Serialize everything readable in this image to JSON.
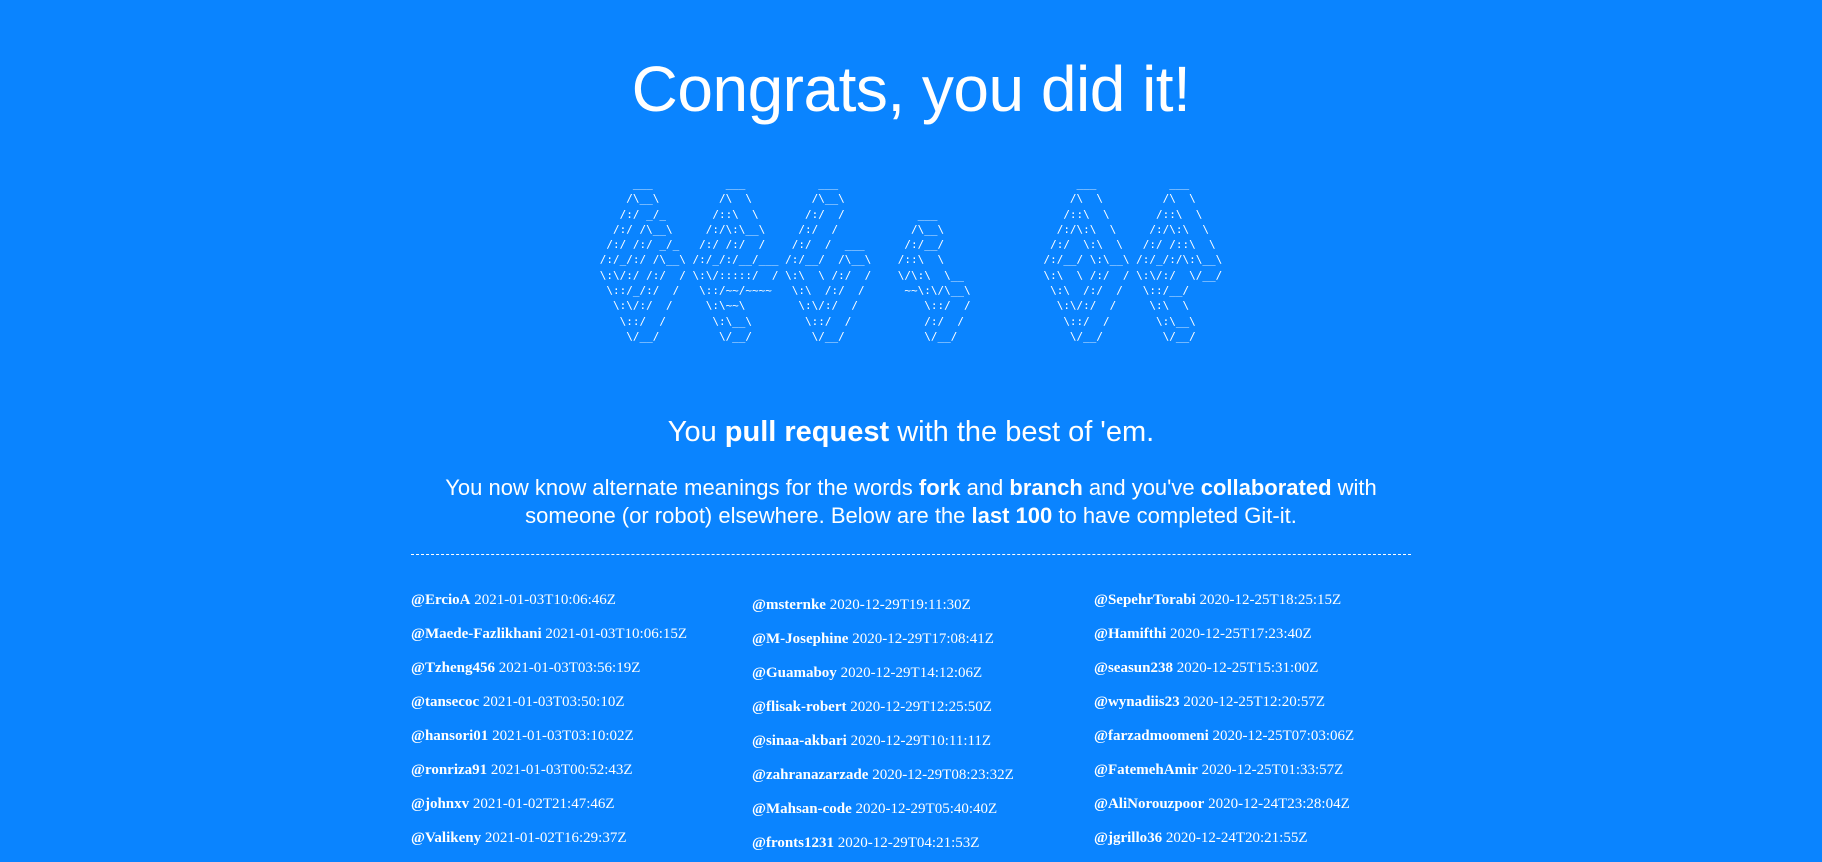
{
  "heading": "Congrats, you did it!",
  "ascii_art": "     ___           ___           ___                                    ___           ___     \n    /\\__\\         /\\  \\         /\\__\\                                  /\\  \\         /\\  \\    \n   /:/ _/_       /::\\  \\       /:/  /           ___                   /::\\  \\       /::\\  \\   \n  /:/ /\\__\\     /:/\\:\\__\\     /:/  /           /\\__\\                 /:/\\:\\  \\     /:/\\:\\  \\  \n /:/ /:/ _/_   /:/ /:/  /    /:/  /  ___      /:/__/                /:/  \\:\\  \\   /:/ /::\\  \\ \n/:/_/:/ /\\__\\ /:/_/:/__/___ /:/__/  /\\__\\    /::\\  \\               /:/__/ \\:\\__\\ /:/_/:/\\:\\__\\\n\\:\\/:/ /:/  / \\:\\/:::::/  / \\:\\  \\ /:/  /    \\/\\:\\  \\__            \\:\\  \\ /:/  / \\:\\/:/  \\/__/\n \\::/_/:/  /   \\::/~~/~~~~   \\:\\  /:/  /      ~~\\:\\/\\__\\            \\:\\  /:/  /   \\::/__/     \n  \\:\\/:/  /     \\:\\~~\\        \\:\\/:/  /          \\::/  /             \\:\\/:/  /     \\:\\  \\     \n   \\::/  /       \\:\\__\\        \\::/  /           /:/  /               \\::/  /       \\:\\__\\    \n    \\/__/         \\/__/         \\/__/            \\/__/                 \\/__/         \\/__/    ",
  "tagline": {
    "prefix": "You ",
    "bold": "pull request",
    "suffix": " with the best of 'em."
  },
  "description": {
    "p1": "You now know alternate meanings for the words ",
    "b1": "fork",
    "p2": " and ",
    "b2": "branch",
    "p3": " and you've ",
    "b3": "collaborated",
    "p4": " with someone (or robot) elsewhere. Below are the ",
    "b4": "last 100",
    "p5": " to have completed Git-it."
  },
  "completions": {
    "column1": [
      {
        "user": "@ErcioA",
        "time": "2021-01-03T10:06:46Z"
      },
      {
        "user": "@Maede-Fazlikhani",
        "time": "2021-01-03T10:06:15Z"
      },
      {
        "user": "@Tzheng456",
        "time": "2021-01-03T03:56:19Z"
      },
      {
        "user": "@tansecoc",
        "time": "2021-01-03T03:50:10Z"
      },
      {
        "user": "@hansori01",
        "time": "2021-01-03T03:10:02Z"
      },
      {
        "user": "@ronriza91",
        "time": "2021-01-03T00:52:43Z"
      },
      {
        "user": "@johnxv",
        "time": "2021-01-02T21:47:46Z"
      },
      {
        "user": "@Valikeny",
        "time": "2021-01-02T16:29:37Z"
      }
    ],
    "column2": [
      {
        "user": "@msternke",
        "time": "2020-12-29T19:11:30Z"
      },
      {
        "user": "@M-Josephine",
        "time": "2020-12-29T17:08:41Z"
      },
      {
        "user": "@Guamaboy",
        "time": "2020-12-29T14:12:06Z"
      },
      {
        "user": "@flisak-robert",
        "time": "2020-12-29T12:25:50Z"
      },
      {
        "user": "@sinaa-akbari",
        "time": "2020-12-29T10:11:11Z"
      },
      {
        "user": "@zahranazarzade",
        "time": "2020-12-29T08:23:32Z"
      },
      {
        "user": "@Mahsan-code",
        "time": "2020-12-29T05:40:40Z"
      },
      {
        "user": "@fronts1231",
        "time": "2020-12-29T04:21:53Z"
      }
    ],
    "column3": [
      {
        "user": "@SepehrTorabi",
        "time": "2020-12-25T18:25:15Z"
      },
      {
        "user": "@Hamifthi",
        "time": "2020-12-25T17:23:40Z"
      },
      {
        "user": "@seasun238",
        "time": "2020-12-25T15:31:00Z"
      },
      {
        "user": "@wynadiis23",
        "time": "2020-12-25T12:20:57Z"
      },
      {
        "user": "@farzadmoomeni",
        "time": "2020-12-25T07:03:06Z"
      },
      {
        "user": "@FatemehAmir",
        "time": "2020-12-25T01:33:57Z"
      },
      {
        "user": "@AliNorouzpoor",
        "time": "2020-12-24T23:28:04Z"
      },
      {
        "user": "@jgrillo36",
        "time": "2020-12-24T20:21:55Z"
      }
    ]
  },
  "colors": {
    "background": "#0a84ff",
    "text": "#ffffff"
  }
}
